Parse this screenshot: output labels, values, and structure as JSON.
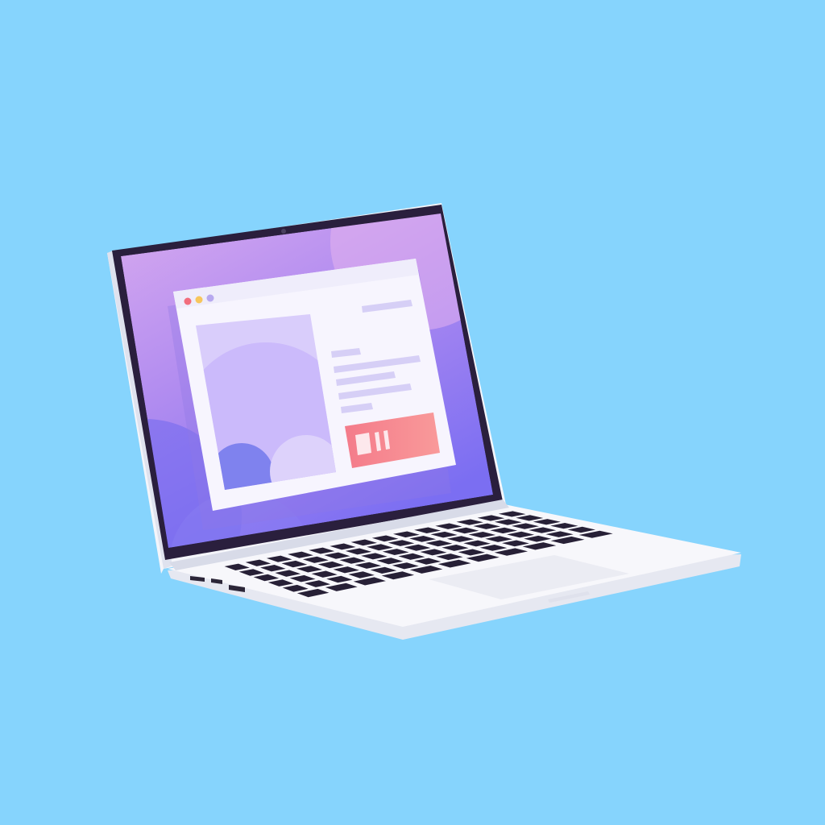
{
  "scene": {
    "subject": "laptop-illustration",
    "colors": {
      "background": "#86d4fd",
      "bezel": "#2a1f3d",
      "lid_edge": "#f4f5fa",
      "wallpaper_top": "#d7a9ef",
      "wallpaper_mid": "#b18cf0",
      "wallpaper_bottom": "#7b6ef2",
      "window_bg": "#f7f5fe",
      "window_titlebar": "#efedfb",
      "traffic_red": "#f26d7d",
      "traffic_yellow": "#f7c65c",
      "traffic_purple": "#b7a8ef",
      "text_line": "#d6cff6",
      "image_panel": "#d9cdfb",
      "image_blob_light": "#c8b6fa",
      "image_blob_dark": "#7f82ee",
      "button_start": "#f47b8a",
      "button_end": "#f99a9a",
      "button_glyph": "#fde8ec",
      "keyboard_key": "#272036",
      "base_top": "#f7f7fb",
      "base_front": "#e6e8f1",
      "trackpad": "#ebecf3",
      "port": "#2c2638"
    },
    "icons": {
      "window_controls": [
        "close-dot-icon",
        "minimize-dot-icon",
        "expand-dot-icon"
      ],
      "button_glyph": "pause-square-icon"
    }
  }
}
